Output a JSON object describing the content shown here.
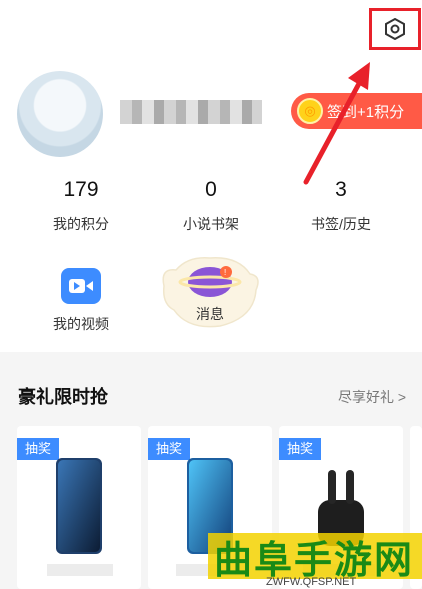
{
  "header": {
    "settings_icon": "gear-icon"
  },
  "profile": {
    "avatar_icon": "avatar-icon",
    "signin_label": "签到+1积分",
    "signin_coin_icon": "coin-icon"
  },
  "stats": [
    {
      "value": "179",
      "label": "我的积分"
    },
    {
      "value": "0",
      "label": "小说书架"
    },
    {
      "value": "3",
      "label": "书签/历史"
    }
  ],
  "features": {
    "video_label": "我的视频",
    "message_label": "消息",
    "message_badge": "!"
  },
  "section": {
    "title": "豪礼限时抢",
    "more_label": "尽享好礼 >"
  },
  "cards": [
    {
      "badge": "抽奖"
    },
    {
      "badge": "抽奖"
    },
    {
      "badge": "抽奖"
    }
  ],
  "watermark": {
    "title": "曲阜手游网",
    "url": "ZWFW.QFSP.NET"
  },
  "colors": {
    "accent_red": "#e8212a",
    "signin_bg": "#ff5a46",
    "badge_blue": "#3d8cff",
    "watermark_green": "#1a8a16"
  }
}
